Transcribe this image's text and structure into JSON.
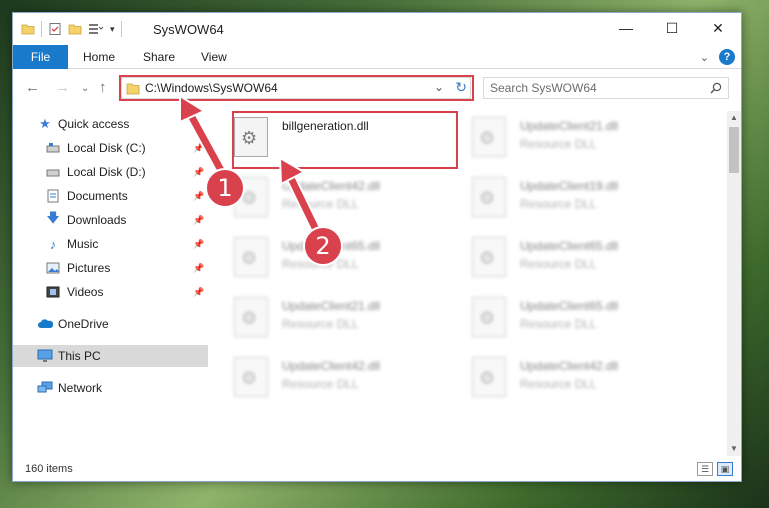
{
  "window": {
    "title": "SysWOW64",
    "controls": {
      "minimize": "—",
      "maximize": "☐",
      "close": "✕"
    }
  },
  "ribbon": {
    "tabs": [
      "File",
      "Home",
      "Share",
      "View"
    ],
    "help": "?"
  },
  "address": {
    "path": "C:\\Windows\\SysWOW64",
    "search_placeholder": "Search SysWOW64"
  },
  "sidebar": {
    "quick_access": "Quick access",
    "items": [
      {
        "label": "Local Disk (C:)",
        "pinned": true
      },
      {
        "label": "Local Disk (D:)",
        "pinned": true
      },
      {
        "label": "Documents",
        "pinned": true
      },
      {
        "label": "Downloads",
        "pinned": true
      },
      {
        "label": "Music",
        "pinned": true
      },
      {
        "label": "Pictures",
        "pinned": true
      },
      {
        "label": "Videos",
        "pinned": true
      }
    ],
    "onedrive": "OneDrive",
    "this_pc": "This PC",
    "network": "Network"
  },
  "files": [
    {
      "name": "billgeneration.dll",
      "type": ""
    },
    {
      "name": "UpdateClient21.dll",
      "type": "Resource DLL"
    },
    {
      "name": "UpdateClient42.dll",
      "type": "Resource DLL"
    },
    {
      "name": "UpdateClient19.dll",
      "type": "Resource DLL"
    },
    {
      "name": "UpdateClient65.dll",
      "type": "Resource DLL"
    },
    {
      "name": "UpdateClient65.dll",
      "type": "Resource DLL"
    },
    {
      "name": "UpdateClient21.dll",
      "type": "Resource DLL"
    },
    {
      "name": "UpdateClient65.dll",
      "type": "Resource DLL"
    },
    {
      "name": "UpdateClient42.dll",
      "type": "Resource DLL"
    },
    {
      "name": "UpdateClient42.dll",
      "type": "Resource DLL"
    }
  ],
  "status": {
    "item_count": "160 items"
  },
  "annotations": {
    "step1": "1",
    "step2": "2",
    "color": "#d9414d"
  }
}
